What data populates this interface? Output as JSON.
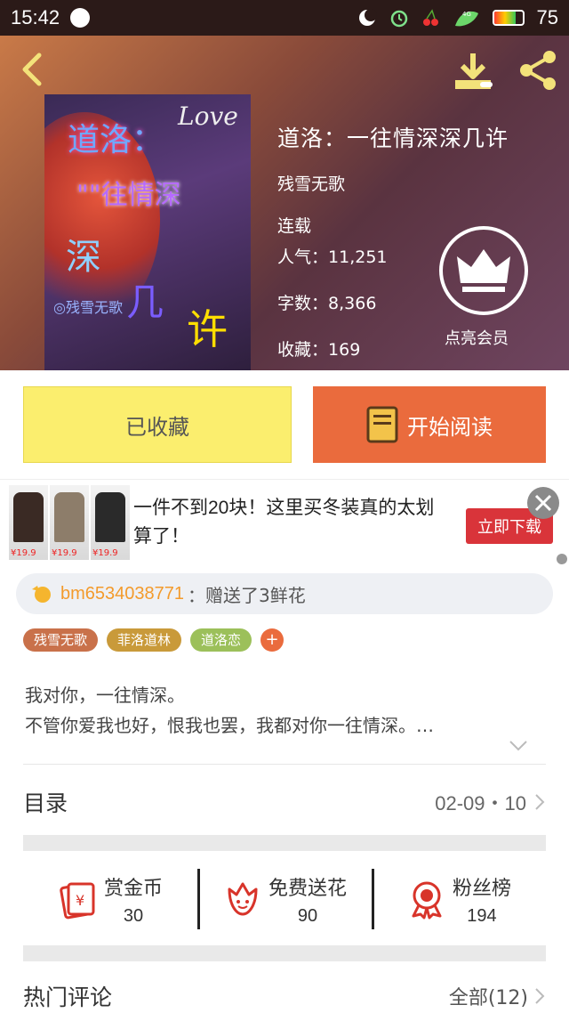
{
  "status_bar": {
    "time": "15:42",
    "battery": "75",
    "battery_level": 0.75,
    "network": "4G"
  },
  "book": {
    "title": "道洛：一往情深深几许",
    "author": "残雪无歌",
    "status": "连载",
    "popularity_label": "人气：",
    "popularity": "11,251",
    "word_count_label": "字数：",
    "word_count": "8,366",
    "favorites_label": "收藏：",
    "favorites": "169",
    "vip_label": "点亮会员",
    "cover": {
      "love": "Love",
      "line1": "道洛：",
      "line2": "\"\"往情深",
      "line3": "深",
      "line4": "几",
      "line5": "许",
      "author": "◎残雪无歌"
    }
  },
  "actions": {
    "collected_label": "已收藏",
    "read_label": "开始阅读"
  },
  "ad": {
    "text": "一件不到20块！这里买冬装真的太划算了！",
    "cta": "立即下载",
    "prices": [
      "¥19.9",
      "¥19.9",
      "¥19.9"
    ]
  },
  "gift": {
    "user": "bm6534038771",
    "message": "：赠送了3鲜花"
  },
  "tags": [
    {
      "label": "残雪无歌",
      "color": "#c9714a"
    },
    {
      "label": "菲洛道林",
      "color": "#c99a3a"
    },
    {
      "label": "道洛恋",
      "color": "#9cc05a"
    }
  ],
  "tag_add": "+",
  "description": {
    "line1": "我对你，一往情深。",
    "line2": "不管你爱我也好，恨我也罢，我都对你一往情深。…"
  },
  "catalog": {
    "label": "目录",
    "date": "02-09・10"
  },
  "stats": [
    {
      "label": "赏金币",
      "value": "30",
      "icon": "red-envelope-icon"
    },
    {
      "label": "免费送花",
      "value": "90",
      "icon": "flower-icon"
    },
    {
      "label": "粉丝榜",
      "value": "194",
      "icon": "medal-icon"
    }
  ],
  "hot_comments": {
    "label": "热门评论",
    "all": "全部(12)"
  },
  "colors": {
    "accent": "#ea6b3d",
    "collected_bg": "#fbee6e",
    "ad_cta": "#d9343a",
    "gift_user": "#f39a2b"
  }
}
